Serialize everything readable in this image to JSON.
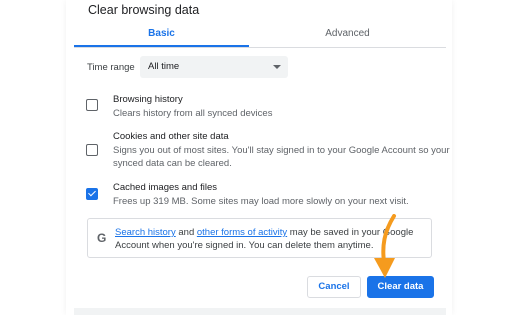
{
  "dialog": {
    "title": "Clear browsing data"
  },
  "tabs": [
    {
      "label": "Basic",
      "active": true
    },
    {
      "label": "Advanced",
      "active": false
    }
  ],
  "time_range": {
    "label": "Time range",
    "value": "All time"
  },
  "options": [
    {
      "title": "Browsing history",
      "desc": "Clears history from all synced devices",
      "checked": false
    },
    {
      "title": "Cookies and other site data",
      "desc": "Signs you out of most sites. You'll stay signed in to your Google Account so your synced data can be cleared.",
      "checked": false
    },
    {
      "title": "Cached images and files",
      "desc": "Frees up 319 MB. Some sites may load more slowly on your next visit.",
      "checked": true
    }
  ],
  "info": {
    "icon": "G",
    "link1": "Search history",
    "text1": " and ",
    "link2": "other forms of activity",
    "text2": " may be saved in your Google Account when you're signed in. You can delete them anytime."
  },
  "buttons": {
    "cancel": "Cancel",
    "clear": "Clear data"
  },
  "colors": {
    "accent": "#1a73e8",
    "arrow": "#f59b1e"
  }
}
